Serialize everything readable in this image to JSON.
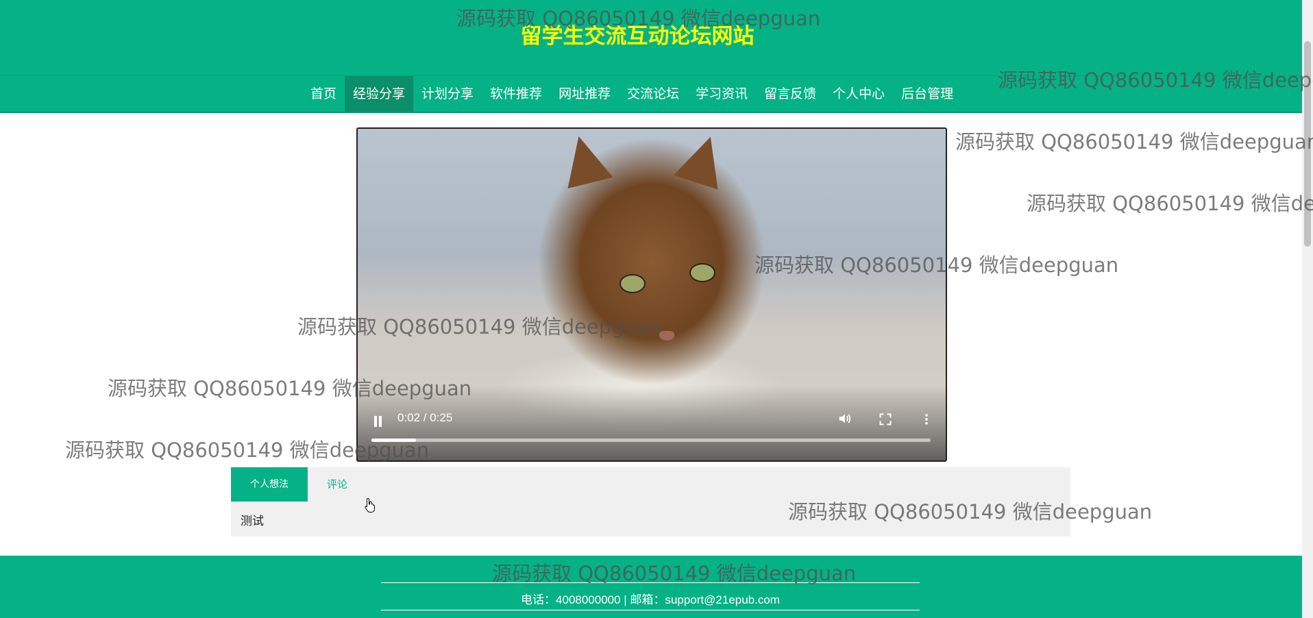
{
  "header": {
    "title": "留学生交流互动论坛网站"
  },
  "nav": {
    "items": [
      {
        "label": "首页"
      },
      {
        "label": "经验分享"
      },
      {
        "label": "计划分享"
      },
      {
        "label": "软件推荐"
      },
      {
        "label": "网址推荐"
      },
      {
        "label": "交流论坛"
      },
      {
        "label": "学习资讯"
      },
      {
        "label": "留言反馈"
      },
      {
        "label": "个人中心"
      },
      {
        "label": "后台管理"
      }
    ],
    "active": "经验分享"
  },
  "video": {
    "time": "0:02 / 0:25",
    "progress": 0.08,
    "icons": [
      "pause-icon",
      "volume-icon",
      "fullscreen-icon",
      "more-options-icon"
    ]
  },
  "tabs": {
    "items": [
      {
        "label": "个人想法"
      },
      {
        "label": "评论"
      }
    ],
    "active": "个人想法",
    "content": "测试"
  },
  "footer": {
    "contact": "电话：4008000000 | 邮箱：support@21epub.com"
  },
  "watermark": {
    "text": "源码获取 QQ86050149 微信deepguan"
  },
  "colors": {
    "brand": "#05b285",
    "title": "#ffff00"
  }
}
